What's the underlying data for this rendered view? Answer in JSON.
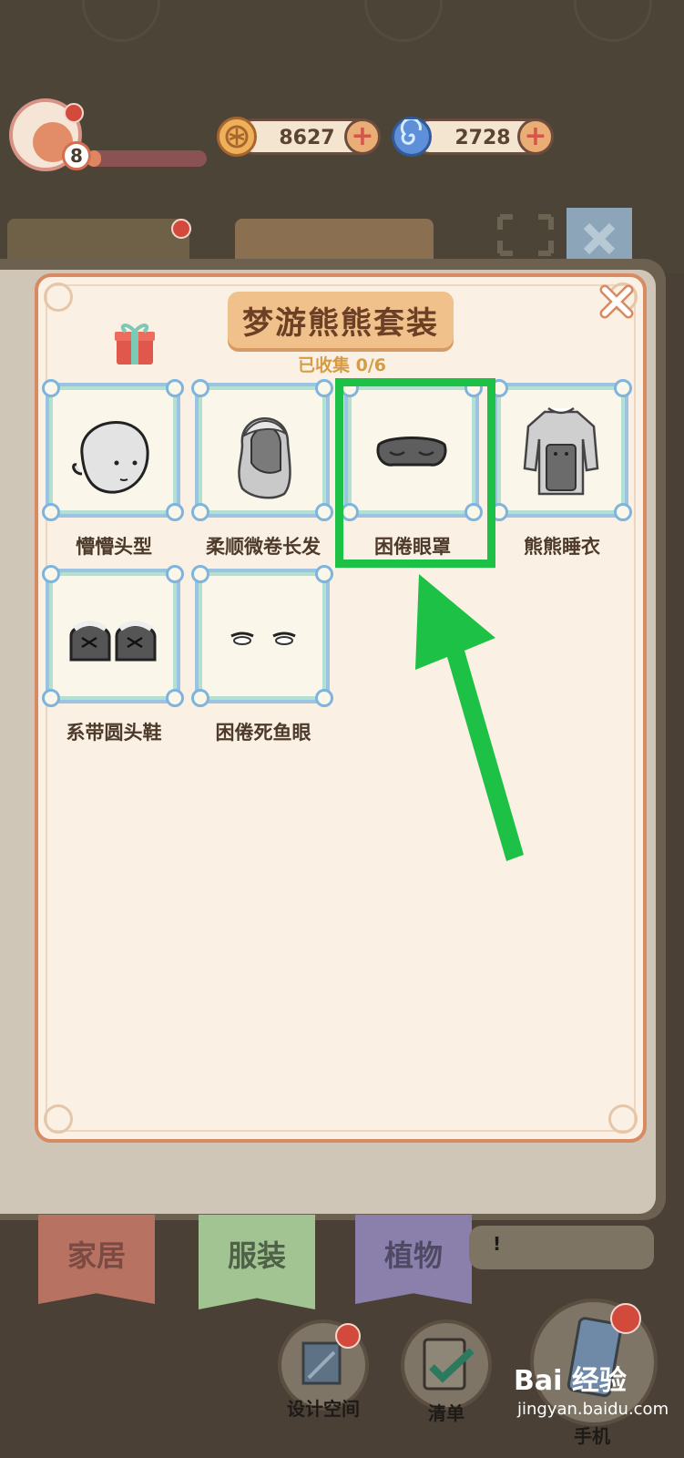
{
  "header": {
    "level": "8",
    "xp_fraction": 0.12,
    "currency_coins": "8627",
    "currency_gems": "2728",
    "plus_glyph": "+"
  },
  "panel": {
    "title": "梦游熊熊套装",
    "collected": "已收集 0/6"
  },
  "items": [
    {
      "label": "懵懵头型",
      "icon": "bald-head"
    },
    {
      "label": "柔顺微卷长发",
      "icon": "long-hair"
    },
    {
      "label": "困倦眼罩",
      "icon": "sleep-mask"
    },
    {
      "label": "熊熊睡衣",
      "icon": "bear-pajamas"
    },
    {
      "label": "系带圆头鞋",
      "icon": "tie-shoes"
    },
    {
      "label": "困倦死鱼眼",
      "icon": "sleepy-eyes"
    }
  ],
  "bottom_tabs": [
    {
      "label": "家居",
      "color": "#c97c68"
    },
    {
      "label": "服装",
      "color": "#9fc893"
    },
    {
      "label": "植物",
      "color": "#9a8ec2"
    }
  ],
  "bubble_text": "!",
  "bottom_buttons": {
    "design": "设计空间",
    "list": "清单",
    "phone": "手机"
  },
  "watermark": {
    "brand": "Bai 经验",
    "url": "jingyan.baidu.com"
  },
  "colors": {
    "highlight": "#1cc145",
    "arrow": "#1cc145",
    "panel_border": "#d88a63",
    "title_bg": "#f1c18c"
  }
}
